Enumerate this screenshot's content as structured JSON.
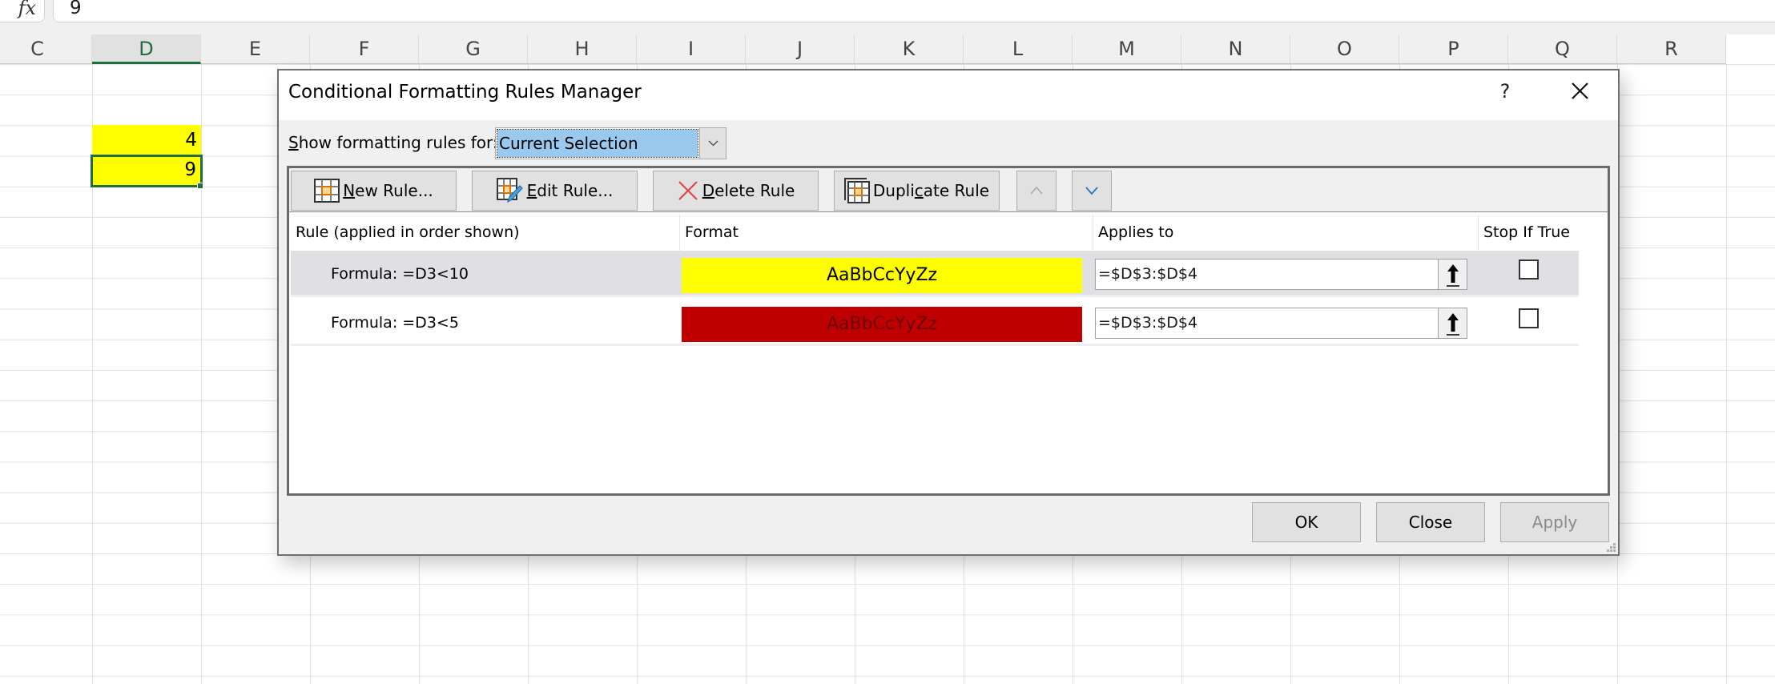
{
  "formula_bar": {
    "fx_label": "fx",
    "value": "9"
  },
  "columns": [
    "C",
    "D",
    "E",
    "F",
    "G",
    "H",
    "I",
    "J",
    "K",
    "L",
    "M",
    "N",
    "O",
    "P",
    "Q",
    "R"
  ],
  "selected_column": "D",
  "cells": [
    {
      "ref": "D3",
      "value": "4",
      "fill": "#ffff00"
    },
    {
      "ref": "D4",
      "value": "9",
      "fill": "#ffff00",
      "active": true
    }
  ],
  "dialog": {
    "title": "Conditional Formatting Rules Manager",
    "help_label": "?",
    "show_rules_label_access": "S",
    "show_rules_label_rest": "how formatting rules for:",
    "scope_selected": "Current Selection",
    "toolbar": {
      "new_rule": {
        "access": "N",
        "rest": "ew Rule..."
      },
      "edit_rule": {
        "access": "E",
        "rest": "dit Rule..."
      },
      "delete_rule": {
        "access": "D",
        "rest": "elete Rule"
      },
      "duplicate_rule": {
        "pre": "Dupli",
        "access": "c",
        "rest": "ate Rule"
      },
      "move_up": "^",
      "move_down": "v"
    },
    "columns": {
      "rule": "Rule (applied in order shown)",
      "format": "Format",
      "applies_to": "Applies to",
      "stop_if_true": "Stop If True"
    },
    "rules": [
      {
        "rule": "Formula: =D3<10",
        "preview_text": "AaBbCcYyZz",
        "preview_fill": "#ffff00",
        "preview_color": "#000000",
        "applies_to": "=$D$3:$D$4",
        "stop_if_true": false,
        "selected": true
      },
      {
        "rule": "Formula: =D3<5",
        "preview_text": "AaBbCcYyZz",
        "preview_fill": "#c00000",
        "preview_color": "#6b0000",
        "applies_to": "=$D$3:$D$4",
        "stop_if_true": false,
        "selected": false
      }
    ],
    "buttons": {
      "ok": "OK",
      "close": "Close",
      "apply": "Apply"
    }
  },
  "colors": {
    "excel_green": "#1e6e42",
    "selection_blue": "#99c9ef",
    "row_selected": "#e0e0e4"
  }
}
